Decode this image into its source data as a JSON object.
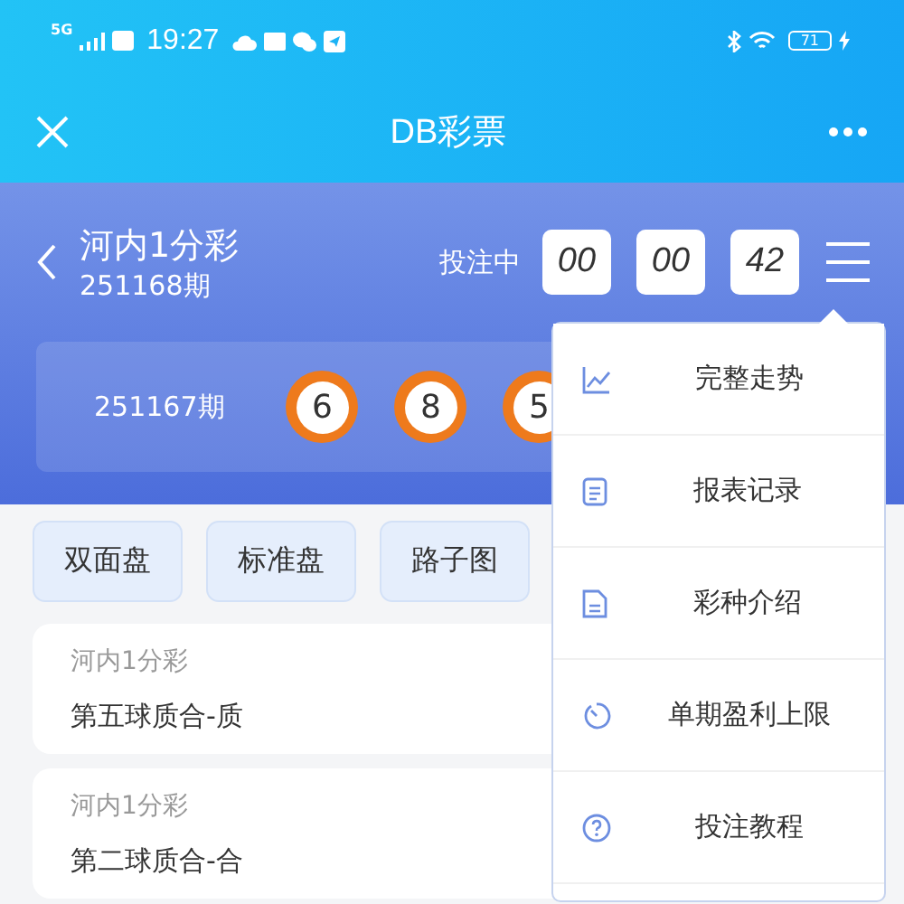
{
  "status_bar": {
    "time": "19:27",
    "network": "5G",
    "battery": "71"
  },
  "title_bar": {
    "title": "DB彩票"
  },
  "game": {
    "name": "河内1分彩",
    "issue": "251168期",
    "state": "投注中",
    "countdown": [
      "00",
      "00",
      "42"
    ]
  },
  "last_draw": {
    "issue": "251167期",
    "balls": [
      "6",
      "8",
      "5"
    ]
  },
  "tabs": [
    {
      "label": "双面盘"
    },
    {
      "label": "标准盘"
    },
    {
      "label": "路子图"
    }
  ],
  "records": [
    {
      "game": "河内1分彩",
      "bet": "第五球质合-质"
    },
    {
      "game": "河内1分彩",
      "bet": "第二球质合-合"
    }
  ],
  "menu": [
    {
      "kind": "chart",
      "label": "完整走势"
    },
    {
      "kind": "report",
      "label": "报表记录"
    },
    {
      "kind": "doc",
      "label": "彩种介绍"
    },
    {
      "kind": "timer",
      "label": "单期盈利上限"
    },
    {
      "kind": "help",
      "label": "投注教程"
    }
  ]
}
